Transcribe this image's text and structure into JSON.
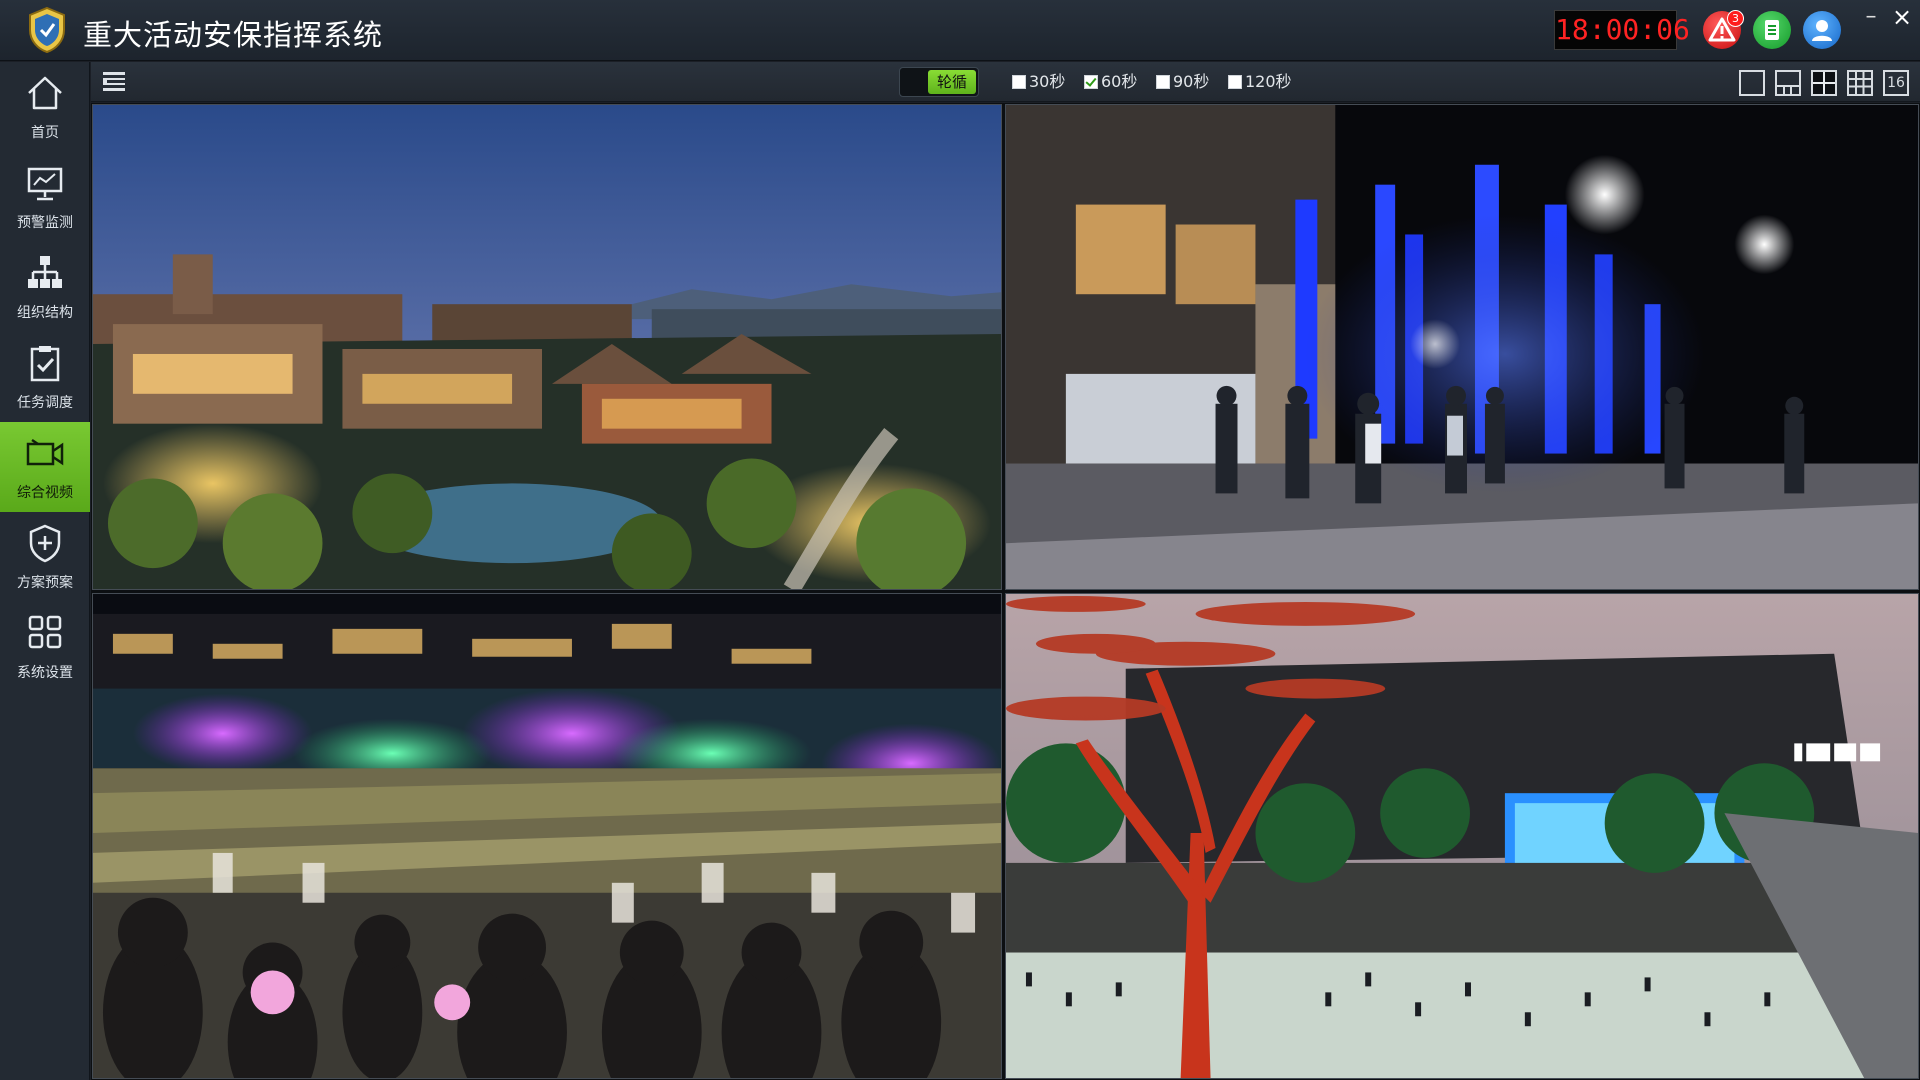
{
  "app": {
    "title": "重大活动安保指挥系统"
  },
  "header": {
    "clock": "18:00:06",
    "alert_count": "3"
  },
  "sidebar": {
    "items": [
      {
        "label": "首页",
        "icon": "home-icon",
        "active": false
      },
      {
        "label": "预警监测",
        "icon": "monitor-icon",
        "active": false
      },
      {
        "label": "组织结构",
        "icon": "org-chart-icon",
        "active": false
      },
      {
        "label": "任务调度",
        "icon": "task-clipboard-icon",
        "active": false
      },
      {
        "label": "综合视频",
        "icon": "video-camera-icon",
        "active": true
      },
      {
        "label": "方案预案",
        "icon": "shield-plus-icon",
        "active": false
      },
      {
        "label": "系统设置",
        "icon": "grid-settings-icon",
        "active": false
      }
    ]
  },
  "toolbar": {
    "loop_label": "轮循",
    "intervals": [
      {
        "label": "30秒",
        "checked": false
      },
      {
        "label": "60秒",
        "checked": true
      },
      {
        "label": "90秒",
        "checked": false
      },
      {
        "label": "120秒",
        "checked": false
      }
    ],
    "layouts": [
      "1",
      "1+5",
      "4",
      "9",
      "16"
    ],
    "selected_layout": "4",
    "layout_16_label": "16"
  },
  "videos": [
    {
      "scene": "resort-town-dusk"
    },
    {
      "scene": "plaza-blue-lit-trees"
    },
    {
      "scene": "crowd-water-light-show"
    },
    {
      "scene": "imax-plaza-red-tree-sculpture"
    }
  ],
  "colors": {
    "accent": "#6cbd26",
    "clock": "#ff2323",
    "alert": "#d81414",
    "doc": "#1fa032",
    "user": "#1c73d8"
  }
}
